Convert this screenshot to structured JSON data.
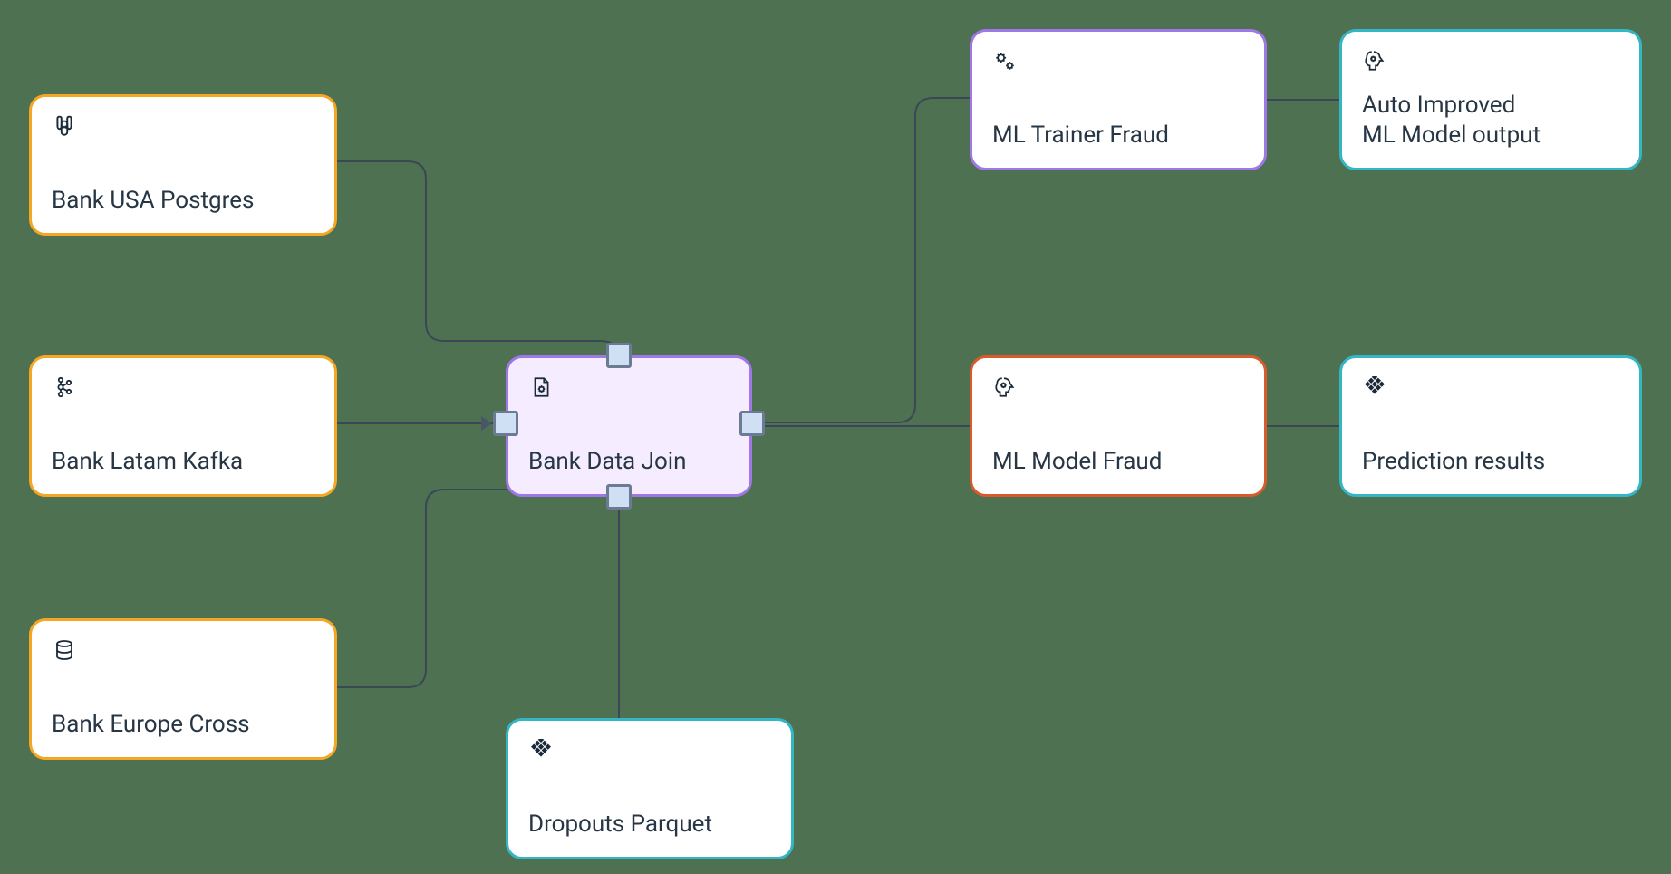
{
  "colors": {
    "orange": "#f5a623",
    "purple": "#a077e6",
    "teal": "#34b6c4",
    "red": "#d95a2b",
    "handle_fill": "#cfe0f5",
    "handle_border": "#6c7a93",
    "edge": "#3b4656",
    "bg": "#4e7152",
    "selected_fill": "#f5edff"
  },
  "nodes": {
    "bank_usa_postgres": {
      "label": "Bank USA Postgres",
      "icon": "postgres-icon"
    },
    "bank_latam_kafka": {
      "label": "Bank Latam Kafka",
      "icon": "kafka-icon"
    },
    "bank_europe_cross": {
      "label": "Bank Europe Cross",
      "icon": "database-icon"
    },
    "bank_data_join": {
      "label": "Bank Data Join",
      "icon": "page-gear-icon"
    },
    "dropouts_parquet": {
      "label": "Dropouts Parquet",
      "icon": "parquet-icon"
    },
    "ml_trainer_fraud": {
      "label": "ML Trainer Fraud",
      "icon": "gears-icon"
    },
    "ml_model_fraud": {
      "label": "ML Model Fraud",
      "icon": "brain-gear-icon"
    },
    "auto_improved_output": {
      "label_line1": "Auto Improved",
      "label_line2": "ML Model output",
      "icon": "brain-gear-icon"
    },
    "prediction_results": {
      "label": "Prediction results",
      "icon": "parquet-icon"
    }
  }
}
